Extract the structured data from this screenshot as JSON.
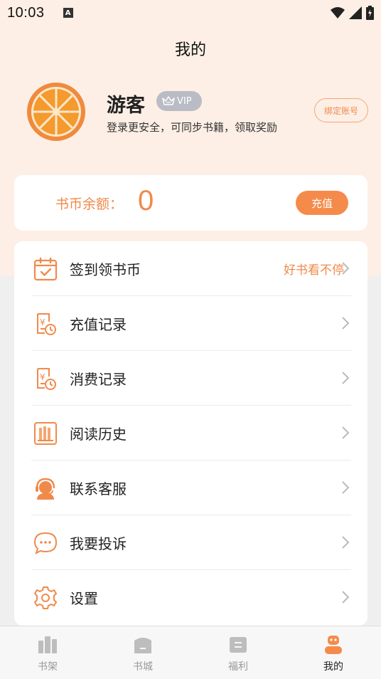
{
  "status_bar": {
    "time": "10:03",
    "notification_icon": "a-letter-icon",
    "icons": [
      "wifi-icon",
      "signal-icon",
      "battery-icon"
    ]
  },
  "header": {
    "title": "我的"
  },
  "profile": {
    "username": "游客",
    "vip_label": "VIP",
    "login_hint": "登录更安全，可同步书籍，领取奖励",
    "bind_button": "绑定账号",
    "avatar_icon": "orange-slice-icon"
  },
  "balance": {
    "label": "书币余额：",
    "value": "0",
    "recharge_button": "充值"
  },
  "menu": {
    "items": [
      {
        "label": "签到领书币",
        "hint": "好书看不停",
        "icon": "calendar-check-icon"
      },
      {
        "label": "充值记录",
        "hint": "",
        "icon": "recharge-record-icon"
      },
      {
        "label": "消费记录",
        "hint": "",
        "icon": "consume-record-icon"
      },
      {
        "label": "阅读历史",
        "hint": "",
        "icon": "books-icon"
      },
      {
        "label": "联系客服",
        "hint": "",
        "icon": "headset-icon"
      },
      {
        "label": "我要投诉",
        "hint": "",
        "icon": "chat-bubble-icon"
      },
      {
        "label": "设置",
        "hint": "",
        "icon": "gear-icon"
      }
    ]
  },
  "tabbar": {
    "tabs": [
      {
        "label": "书架",
        "icon": "bookshelf-icon",
        "active": false
      },
      {
        "label": "书城",
        "icon": "bookstore-icon",
        "active": false
      },
      {
        "label": "福利",
        "icon": "welfare-icon",
        "active": false
      },
      {
        "label": "我的",
        "icon": "profile-icon",
        "active": true
      }
    ]
  },
  "colors": {
    "accent": "#f58b4b",
    "header_bg": "#fdefe6",
    "page_bg": "#efefef",
    "vip_badge": "#b9bcc4"
  }
}
